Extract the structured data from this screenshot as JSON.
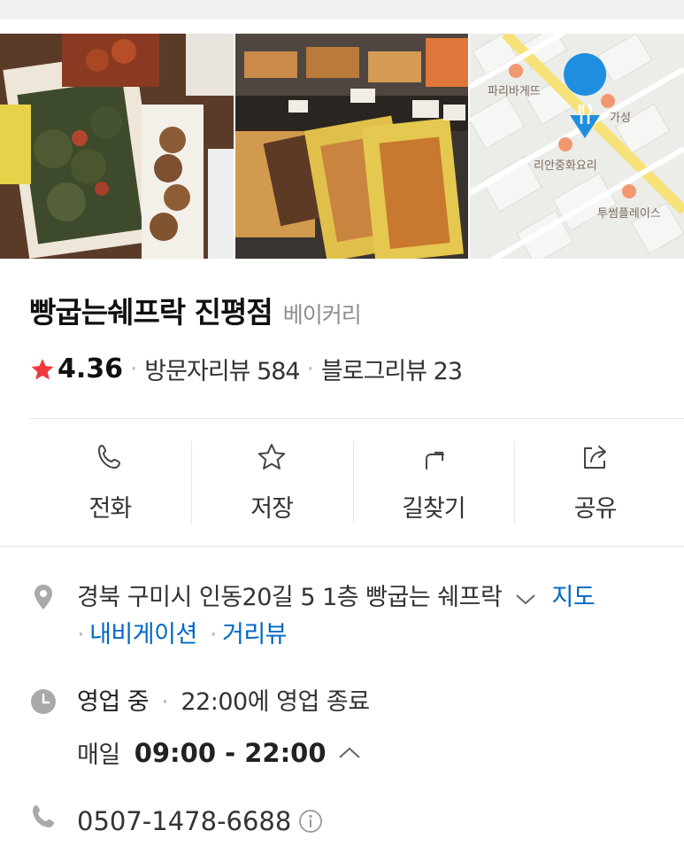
{
  "place": {
    "name": "빵굽는쉐프락 진평점",
    "category": "베이커리",
    "rating": "4.36",
    "visitor_reviews": "방문자리뷰 584",
    "blog_reviews": "블로그리뷰 23"
  },
  "photos": {
    "map_labels": [
      "파리바게뜨",
      "가성",
      "리안중화요리",
      "투썸플레이스"
    ]
  },
  "actions": [
    {
      "label": "전화",
      "icon": "phone-icon"
    },
    {
      "label": "저장",
      "icon": "star-outline-icon"
    },
    {
      "label": "길찾기",
      "icon": "directions-icon"
    },
    {
      "label": "공유",
      "icon": "share-icon"
    }
  ],
  "address": {
    "text": "경북 구미시 인동20길 5 1층 빵굽는 쉐프락",
    "map_link": "지도",
    "navigation_link": "내비게이션",
    "street_view_link": "거리뷰"
  },
  "hours": {
    "status": "영업 중",
    "closing": "22:00에 영업 종료",
    "days": "매일",
    "range": "09:00 - 22:00"
  },
  "phone": {
    "number": "0507-1478-6688"
  },
  "colors": {
    "accent_link": "#0068c3",
    "star": "#f0383d",
    "map_pin": "#1f8ee0"
  }
}
